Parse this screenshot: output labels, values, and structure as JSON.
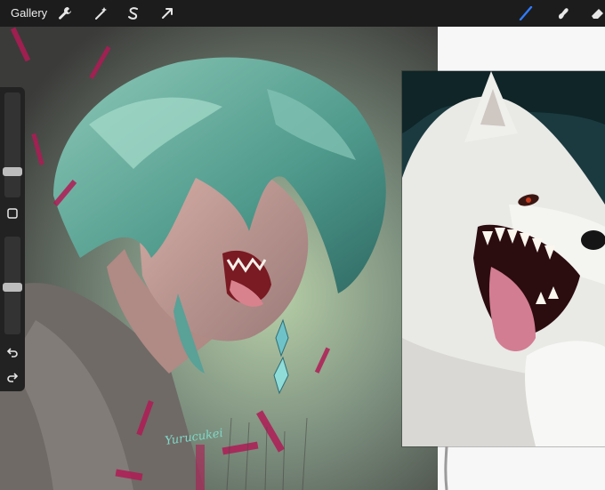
{
  "toolbar": {
    "gallery_label": "Gallery",
    "tools": [
      {
        "name": "actions",
        "icon": "wrench-icon"
      },
      {
        "name": "adjustments",
        "icon": "magic-wand-icon"
      },
      {
        "name": "selection",
        "icon": "selection-s-icon"
      },
      {
        "name": "transform",
        "icon": "arrow-cursor-icon"
      }
    ],
    "right_tools": [
      {
        "name": "brush",
        "icon": "brush-icon",
        "active": true
      },
      {
        "name": "smudge",
        "icon": "smudge-icon"
      },
      {
        "name": "eraser",
        "icon": "eraser-icon"
      }
    ]
  },
  "artwork": {
    "signature": "Yurucukei"
  },
  "sidebar": {
    "brush_size_level": 0.72,
    "opacity_level": 0.5,
    "modify_button_icon": "square-icon",
    "undo_icon": "undo-icon",
    "redo_icon": "redo-icon"
  },
  "colors": {
    "accent_blue": "#2f7bff",
    "toolbar_bg": "#1c1c1c",
    "canvas_white": "#f7f7f7"
  }
}
